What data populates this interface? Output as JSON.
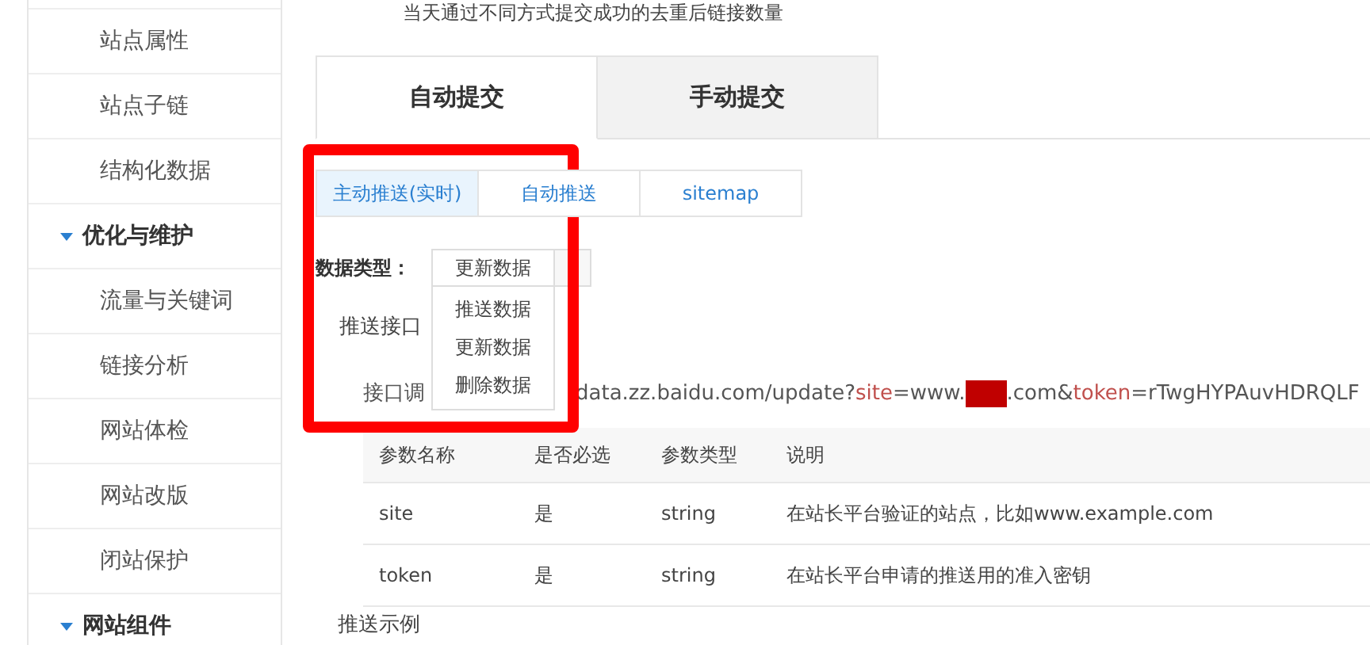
{
  "sidebar": {
    "items": [
      {
        "kind": "item",
        "label": "站点属性"
      },
      {
        "kind": "item",
        "label": "站点子链"
      },
      {
        "kind": "item",
        "label": "结构化数据"
      },
      {
        "kind": "group",
        "label": "优化与维护",
        "expanded": true
      },
      {
        "kind": "item",
        "label": "流量与关键词"
      },
      {
        "kind": "item",
        "label": "链接分析"
      },
      {
        "kind": "item",
        "label": "网站体检"
      },
      {
        "kind": "item",
        "label": "网站改版"
      },
      {
        "kind": "item",
        "label": "闭站保护"
      },
      {
        "kind": "group",
        "label": "网站组件",
        "expanded": true
      }
    ]
  },
  "intro": "当天通过不同方式提交成功的去重后链接数量",
  "tabs": [
    {
      "label": "自动提交",
      "selected": true
    },
    {
      "label": "手动提交",
      "selected": false
    }
  ],
  "subtabs": [
    {
      "label": "主动推送(实时)",
      "selected": true
    },
    {
      "label": "自动推送",
      "selected": false
    },
    {
      "label": "sitemap",
      "selected": false
    }
  ],
  "data_type": {
    "label": "数据类型：",
    "value": "更新数据",
    "expanded": true,
    "options": [
      "推送数据",
      "更新数据",
      "删除数据"
    ]
  },
  "push_api_label": "推送接口",
  "api_call": {
    "label": "接口调",
    "url": [
      {
        "kind": "text",
        "text": "data.zz.baidu.com/update?"
      },
      {
        "kind": "param",
        "text": "site"
      },
      {
        "kind": "text",
        "text": "=www."
      },
      {
        "kind": "redacted"
      },
      {
        "kind": "text",
        "text": ".com&"
      },
      {
        "kind": "param",
        "text": "token"
      },
      {
        "kind": "text",
        "text": "=rTwgHYPAuvHDRQLF"
      }
    ]
  },
  "table": {
    "columns": [
      "参数名称",
      "是否必选",
      "参数类型",
      "说明"
    ],
    "rows": [
      [
        "site",
        "是",
        "string",
        "在站长平台验证的站点，比如www.example.com"
      ],
      [
        "token",
        "是",
        "string",
        "在站长平台申请的推送用的准入密钥"
      ]
    ]
  },
  "example_label": "推送示例",
  "annotation": {
    "kind": "highlight-box"
  }
}
